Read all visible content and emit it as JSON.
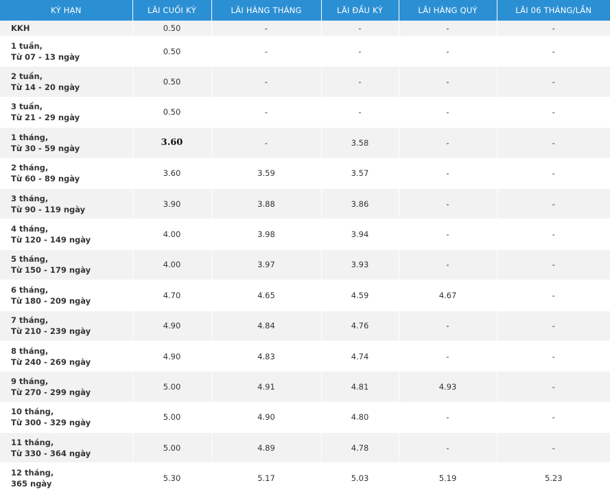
{
  "headers": [
    "KỲ HẠN",
    "LÃI CUỐI KỲ",
    "LÃI HÀNG THÁNG",
    "LÃI ĐẦU KỲ",
    "LÃI HÀNG QUÝ",
    "LÃI 06 THÁNG/LẦN"
  ],
  "rows": [
    {
      "term1": "KKH",
      "term2": "",
      "values": [
        "0.50",
        "-",
        "-",
        "-",
        "-"
      ]
    },
    {
      "term1": "1 tuần,",
      "term2": "Từ 07 - 13 ngày",
      "values": [
        "0.50",
        "-",
        "-",
        "-",
        "-"
      ]
    },
    {
      "term1": "2 tuần,",
      "term2": "Từ 14 - 20 ngày",
      "values": [
        "0.50",
        "-",
        "-",
        "-",
        "-"
      ]
    },
    {
      "term1": "3 tuần,",
      "term2": "Từ 21 - 29 ngày",
      "values": [
        "0.50",
        "-",
        "-",
        "-",
        "-"
      ]
    },
    {
      "term1": "1 tháng,",
      "term2": "Từ 30 - 59 ngày",
      "values": [
        "3.60",
        "-",
        "3.58",
        "-",
        "-"
      ]
    },
    {
      "term1": "2 tháng,",
      "term2": "Từ 60 - 89 ngày",
      "values": [
        "3.60",
        "3.59",
        "3.57",
        "-",
        "-"
      ]
    },
    {
      "term1": "3 tháng,",
      "term2": "Từ 90 - 119 ngày",
      "values": [
        "3.90",
        "3.88",
        "3.86",
        "-",
        "-"
      ]
    },
    {
      "term1": "4 tháng,",
      "term2": "Từ 120 - 149 ngày",
      "values": [
        "4.00",
        "3.98",
        "3.94",
        "-",
        "-"
      ]
    },
    {
      "term1": "5 tháng,",
      "term2": "Từ 150 - 179 ngày",
      "values": [
        "4.00",
        "3.97",
        "3.93",
        "-",
        "-"
      ]
    },
    {
      "term1": "6 tháng,",
      "term2": "Từ 180 - 209 ngày",
      "values": [
        "4.70",
        "4.65",
        "4.59",
        "4.67",
        "-"
      ]
    },
    {
      "term1": "7 tháng,",
      "term2": "Từ 210 - 239 ngày",
      "values": [
        "4.90",
        "4.84",
        "4.76",
        "-",
        "-"
      ]
    },
    {
      "term1": "8 tháng,",
      "term2": "Từ 240 - 269 ngày",
      "values": [
        "4.90",
        "4.83",
        "4.74",
        "-",
        "-"
      ]
    },
    {
      "term1": "9 tháng,",
      "term2": "Từ 270 - 299 ngày",
      "values": [
        "5.00",
        "4.91",
        "4.81",
        "4.93",
        "-"
      ]
    },
    {
      "term1": "10 tháng,",
      "term2": "Từ 300 - 329 ngày",
      "values": [
        "5.00",
        "4.90",
        "4.80",
        "-",
        "-"
      ]
    },
    {
      "term1": "11 tháng,",
      "term2": "Từ 330 - 364 ngày",
      "values": [
        "5.00",
        "4.89",
        "4.78",
        "-",
        "-"
      ]
    },
    {
      "term1": "12 tháng,",
      "term2": "365 ngày",
      "values": [
        "5.30",
        "5.17",
        "5.03",
        "5.19",
        "5.23"
      ]
    }
  ]
}
